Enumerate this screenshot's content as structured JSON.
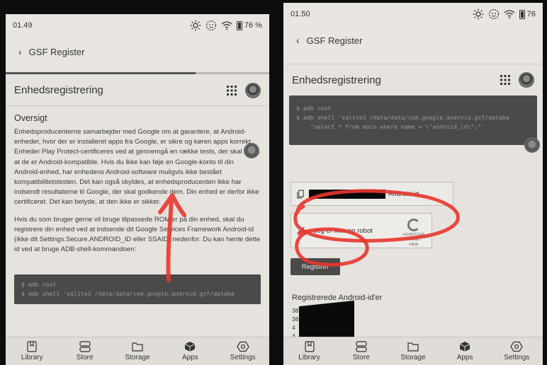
{
  "left": {
    "status": {
      "time": "01.49",
      "battery": "76 %"
    },
    "appbar": {
      "title": "GSF Register"
    },
    "header": {
      "title": "Enhedsregistrering"
    },
    "section_title": "Oversigt",
    "paragraph1": "Enhedsproducenterne samarbejder med Google om at garantere, at Android-enheder, hvor der er installeret apps fra Google, er sikre og køren apps korrekt. Enheder Play Protect-certificeres ved at gennemgå en række tests, der skal sikre, at de er Android-kompatible. Hvis du ikke kan føje en Google-konto til din Android-enhed, har enhedens Android-software muligvis ikke bestået kompatibilitetstesten. Det kan også skyldes, at enhedsproducenten ikke har indsendt resultaterne til Google, der skal godkende dem. Din enhed er derfor ikke certificeret. Det kan betyde, at den ikke er sikker.",
    "paragraph2": "Hvis du som bruger gerne vil bruge tilpassede ROM'er på din enhed, skal du registrere din enhed ved at indsende dit Google Services Framework Android-id (ikke dit Settings.Secure.ANDROID_ID eller SSAID) nedenfor. Du kan hente dette id ved at bruge ADB-shell-kommandoen:",
    "code": [
      "$ adb root",
      "$ adb shell 'sqlite3 /data/data/com.google.android.gsf/databa"
    ]
  },
  "right": {
    "status": {
      "time": "01.50",
      "battery": "76"
    },
    "appbar": {
      "title": "GSF Register"
    },
    "header": {
      "title": "Enhedsregistrering"
    },
    "code": [
      "$ adb root",
      "$ adb shell 'sqlite3 /data/data/com.google.android.gsf/databa",
      "    \"select * from main where name = \\\"android_id\\\";\"'"
    ],
    "id_field_suffix": "Android-id",
    "captcha": {
      "label": "Jeg er ikke en robot",
      "brand": "reCAPTCHA",
      "links": "Privatliv - Vilkår"
    },
    "register_button": "Registrer",
    "registered_heading": "Registrerede Android-id'er",
    "registered_items": [
      "38",
      "38",
      "4",
      "4"
    ]
  },
  "nav": [
    "Library",
    "Store",
    "Storage",
    "Apps",
    "Settings"
  ],
  "colors": {
    "annotation": "#e8362f",
    "eink_bg": "#e9e6e1",
    "code_bg": "#4a4a4a"
  }
}
